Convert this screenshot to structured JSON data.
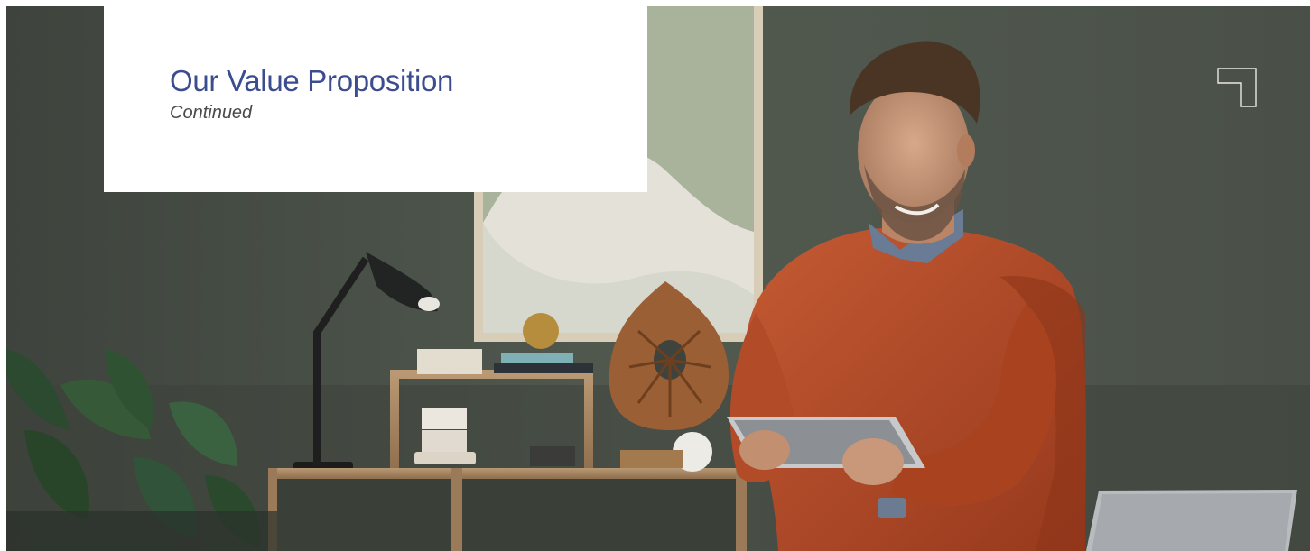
{
  "header": {
    "title": "Our Value Proposition",
    "subtitle": "Continued"
  },
  "hero": {
    "description_hidden": ""
  },
  "colors": {
    "title_color": "#3c4d8f",
    "subtitle_color": "#4a4a4a",
    "card_background": "#ffffff",
    "wall_color": "#4b5148",
    "sweater_color": "#b54a26"
  },
  "icons": {
    "corner_mark": "corner-bracket-icon"
  }
}
